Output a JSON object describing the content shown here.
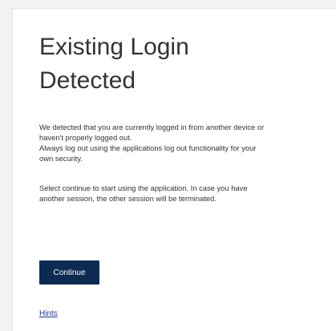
{
  "dialog": {
    "title_line1": "Existing Login",
    "title_line2": "Detected",
    "message_line1": "We detected that you are currently logged in from another device or",
    "message_line2": "haven't properly logged out.",
    "message_line3": "Always log out using the applications log out functionality for your",
    "message_line4": "own security.",
    "info_line1": "Select continue to start using the application. In case you have",
    "info_line2": "another session, the other session will be terminated.",
    "continue_label": "Continue",
    "hints_label": "Hints"
  },
  "colors": {
    "background": "#f2f2f2",
    "card": "#ffffff",
    "button": "#0d2b52",
    "link": "#1a3a8a",
    "text": "#333333"
  }
}
